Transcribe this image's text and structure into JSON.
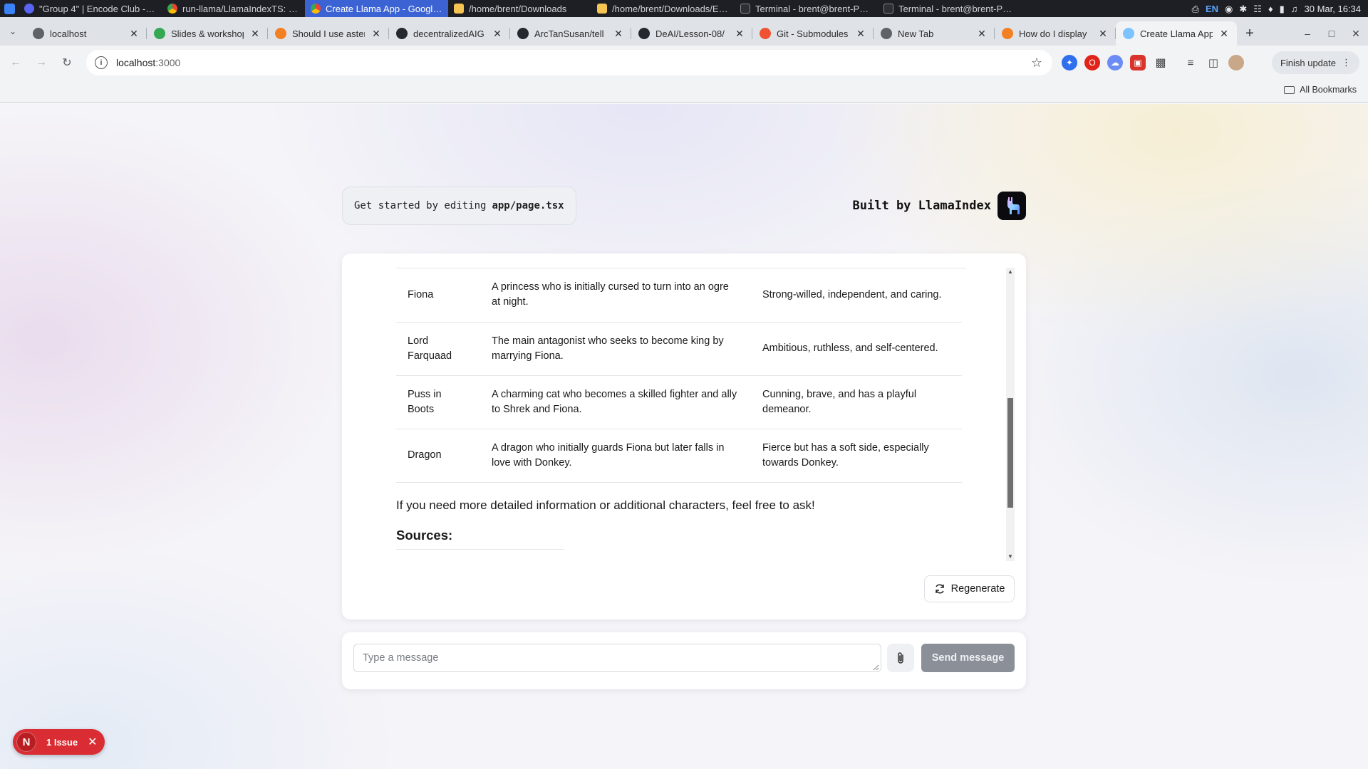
{
  "os_panel": {
    "tasks": [
      {
        "label": "\"Group 4\" | Encode Club - D...",
        "icon": "discord-icon"
      },
      {
        "label": "run-llama/LlamaIndexTS: D...",
        "icon": "chrome-icon"
      },
      {
        "label": "Create Llama App - Google ...",
        "icon": "chrome-icon"
      },
      {
        "label": "/home/brent/Downloads",
        "icon": "folder-icon"
      },
      {
        "label": "/home/brent/Downloads/En...",
        "icon": "folder-icon"
      },
      {
        "label": "Terminal - brent@brent-P65...",
        "icon": "terminal-icon"
      },
      {
        "label": "Terminal - brent@brent-P65...",
        "icon": "terminal-icon"
      }
    ],
    "keyboard_layout": "EN",
    "clock": "30 Mar, 16:34"
  },
  "browser": {
    "tabs": [
      {
        "label": "localhost",
        "icon": "globe-icon",
        "color": "#5f6368"
      },
      {
        "label": "Slides & workshop",
        "icon": "google-drive-icon",
        "color": "#34a853"
      },
      {
        "label": "Should I use asteri",
        "icon": "stackoverflow-icon",
        "color": "#f48024"
      },
      {
        "label": "decentralizedAIG",
        "icon": "github-icon",
        "color": "#24292f"
      },
      {
        "label": "ArcTanSusan/tell",
        "icon": "github-icon",
        "color": "#24292f"
      },
      {
        "label": "DeAI/Lesson-08/",
        "icon": "github-icon",
        "color": "#24292f"
      },
      {
        "label": "Git - Submodules",
        "icon": "git-icon",
        "color": "#f05133"
      },
      {
        "label": "New Tab",
        "icon": "globe-icon",
        "color": "#5f6368"
      },
      {
        "label": "How do I display",
        "icon": "stackoverflow-icon",
        "color": "#f48024"
      },
      {
        "label": "Create Llama App",
        "icon": "llama-icon",
        "color": "#7cc4ff"
      }
    ],
    "active_tab_index": 9,
    "url_host": "localhost",
    "url_port": ":3000",
    "finish_update_label": "Finish update",
    "all_bookmarks_label": "All Bookmarks"
  },
  "page": {
    "header_pill_text": "Get started by editing",
    "header_pill_file": "app/page.tsx",
    "built_by": "Built by LlamaIndex",
    "characters": [
      {
        "name": "Fiona",
        "description": "A princess who is initially cursed to turn into an ogre at night.",
        "traits": "Strong-willed, independent, and caring."
      },
      {
        "name": "Lord Farquaad",
        "description": "The main antagonist who seeks to become king by marrying Fiona.",
        "traits": "Ambitious, ruthless, and self-centered."
      },
      {
        "name": "Puss in Boots",
        "description": "A charming cat who becomes a skilled fighter and ally to Shrek and Fiona.",
        "traits": "Cunning, brave, and has a playful demeanor."
      },
      {
        "name": "Dragon",
        "description": "A dragon who initially guards Fiona but later falls in love with Donkey.",
        "traits": "Fierce but has a soft side, especially towards Donkey."
      }
    ],
    "followup": "If you need more detailed information or additional characters, feel free to ask!",
    "sources_heading": "Sources:",
    "regenerate_label": "Regenerate",
    "input_placeholder": "Type a message",
    "send_label": "Send message",
    "issues_label": "1 Issue",
    "issues_logo_letter": "N"
  }
}
